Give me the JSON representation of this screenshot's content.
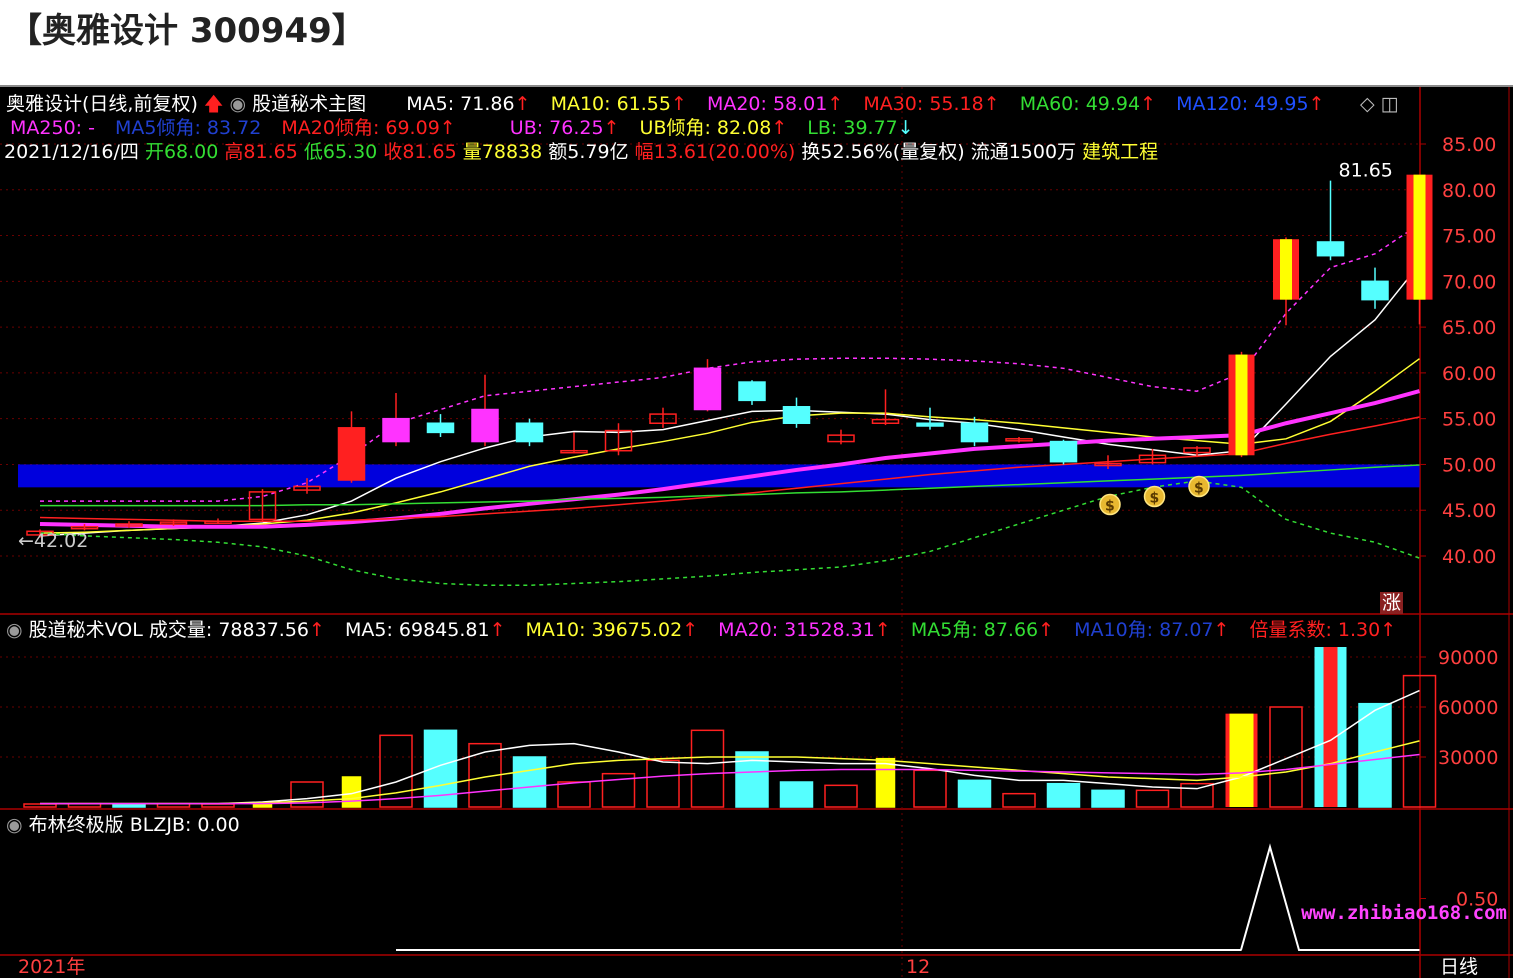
{
  "page_title": "【奥雅设计 300949】",
  "colors": {
    "background": "#000000",
    "grid": "#6a0000",
    "axis": "#aa0000",
    "axis_text": "#ff4040",
    "ma5": "#ffffff",
    "ma10": "#ffff33",
    "ma20": "#ff33ff",
    "ma30": "#ff2020",
    "ma60": "#33dd33",
    "ma120": "#2050ff",
    "band": "#0000dd",
    "boll": "#ff33ff",
    "up": "#ff2020",
    "down": "#55ffff",
    "yellow": "#ffff00",
    "white": "#ffffff",
    "green": "#33dd33",
    "gray": "#cccccc"
  },
  "main_header": {
    "line1": {
      "stock_label": "奥雅设计(日线,前复权)",
      "indicator_name": "股道秘术主图",
      "ma5": "MA5: 71.86",
      "ma10": "MA10: 61.55",
      "ma20": "MA20: 58.01",
      "ma30": "MA30: 55.18",
      "ma60": "MA60: 49.94",
      "ma120": "MA120: 49.95"
    },
    "line2": {
      "ma250": "MA250: -",
      "ma5_angle": "MA5倾角: 83.72",
      "ma20_angle": "MA20倾角: 69.09",
      "ub": "UB: 76.25",
      "ub_angle": "UB倾角: 82.08",
      "lb": "LB: 39.77"
    },
    "line3": {
      "date": "2021/12/16/四",
      "open": "开68.00",
      "high": "高81.65",
      "low": "低65.30",
      "close": "收81.65",
      "volume": "量78838",
      "amount": "额5.79亿",
      "range": "幅13.61(20.00%)",
      "turnover": "换52.56%(量复权)",
      "float": "流通1500万",
      "industry": "建筑工程"
    }
  },
  "vol_header": {
    "name": "股道秘术VOL",
    "volume": "成交量: 78837.56",
    "ma5": "MA5: 69845.81",
    "ma10": "MA10: 39675.02",
    "ma20": "MA20: 31528.31",
    "ma5_angle": "MA5角: 87.66",
    "ma10_angle": "MA10角: 87.07",
    "ratio": "倍量系数: 1.30"
  },
  "boll_header": {
    "name": "布林终极版",
    "value": "BLZJB: 0.00"
  },
  "bottom_axis": {
    "left": "2021年",
    "mid": "12",
    "right": "日线"
  },
  "badge": "涨",
  "watermark": "www.zhibiao168.com",
  "chart_data": [
    {
      "type": "candlestick",
      "y_ticks": [
        "85.00",
        "80.00",
        "75.00",
        "70.00",
        "65.00",
        "60.00",
        "55.00",
        "50.00",
        "45.00",
        "40.00"
      ],
      "ylim": [
        37,
        88
      ],
      "high_annotation": "81.65",
      "low_annotation": "42.02",
      "candles": [
        {
          "o": 42.3,
          "c": 42.7,
          "h": 42.9,
          "l": 42.0
        },
        {
          "o": 43.0,
          "c": 43.2,
          "h": 43.5,
          "l": 42.8
        },
        {
          "o": 43.3,
          "c": 43.5,
          "h": 43.8,
          "l": 43.1
        },
        {
          "o": 43.5,
          "c": 43.7,
          "h": 44.0,
          "l": 43.3
        },
        {
          "o": 43.7,
          "c": 43.8,
          "h": 44.1,
          "l": 43.5
        },
        {
          "o": 44.0,
          "c": 47.0,
          "h": 47.3,
          "l": 43.8
        },
        {
          "o": 47.2,
          "c": 47.6,
          "h": 48.5,
          "l": 46.8
        },
        {
          "o": 48.3,
          "c": 54.0,
          "h": 55.8,
          "l": 48.0
        },
        {
          "o": 52.5,
          "c": 55.0,
          "h": 57.8,
          "l": 52.0
        },
        {
          "o": 54.5,
          "c": 53.5,
          "h": 55.5,
          "l": 53.0
        },
        {
          "o": 52.5,
          "c": 56.0,
          "h": 59.8,
          "l": 52.0
        },
        {
          "o": 54.5,
          "c": 52.5,
          "h": 55.0,
          "l": 52.0
        },
        {
          "o": 51.5,
          "c": 51.5,
          "h": 53.5,
          "l": 51.2
        },
        {
          "o": 51.5,
          "c": 53.7,
          "h": 54.5,
          "l": 51.0
        },
        {
          "o": 54.5,
          "c": 55.5,
          "h": 56.2,
          "l": 54.0
        },
        {
          "o": 56.0,
          "c": 60.5,
          "h": 61.5,
          "l": 55.8
        },
        {
          "o": 59.0,
          "c": 57.0,
          "h": 59.2,
          "l": 56.5
        },
        {
          "o": 56.3,
          "c": 54.5,
          "h": 57.3,
          "l": 54.0
        },
        {
          "o": 52.5,
          "c": 53.2,
          "h": 53.8,
          "l": 52.2
        },
        {
          "o": 54.5,
          "c": 54.9,
          "h": 58.2,
          "l": 54.3
        },
        {
          "o": 54.5,
          "c": 54.2,
          "h": 56.2,
          "l": 53.8
        },
        {
          "o": 54.5,
          "c": 52.5,
          "h": 55.2,
          "l": 52.0
        },
        {
          "o": 52.6,
          "c": 52.8,
          "h": 53.0,
          "l": 52.4
        },
        {
          "o": 52.5,
          "c": 50.3,
          "h": 52.7,
          "l": 50.0
        },
        {
          "o": 50.0,
          "c": 50.1,
          "h": 51.0,
          "l": 49.5
        },
        {
          "o": 50.2,
          "c": 51.0,
          "h": 51.7,
          "l": 50.0
        },
        {
          "o": 51.3,
          "c": 51.8,
          "h": 52.0,
          "l": 50.8
        },
        {
          "o": 51.0,
          "c": 62.0,
          "h": 62.3,
          "l": 50.8
        },
        {
          "o": 68.0,
          "c": 74.6,
          "h": 74.8,
          "l": 65.2
        },
        {
          "o": 74.3,
          "c": 72.8,
          "h": 81.0,
          "l": 72.3
        },
        {
          "o": 70.0,
          "c": 68.0,
          "h": 71.5,
          "l": 67.0
        },
        {
          "o": 68.0,
          "c": 81.65,
          "h": 81.65,
          "l": 65.3
        }
      ],
      "series": [
        {
          "name": "MA5",
          "values": [
            42.2,
            42.5,
            42.8,
            43.0,
            43.2,
            43.6,
            44.5,
            46.0,
            48.5,
            50.3,
            51.8,
            53.0,
            53.6,
            53.5,
            53.8,
            54.8,
            55.8,
            55.9,
            55.7,
            55.5,
            54.9,
            54.5,
            53.8,
            53.0,
            52.2,
            51.6,
            51.0,
            51.5,
            56.6,
            61.8,
            65.8,
            71.86
          ]
        },
        {
          "name": "MA10",
          "values": [
            42.5,
            42.6,
            42.8,
            43.0,
            43.2,
            43.5,
            43.9,
            44.7,
            45.8,
            47.0,
            48.4,
            49.8,
            50.8,
            51.7,
            52.5,
            53.4,
            54.6,
            55.3,
            55.6,
            55.6,
            55.2,
            54.9,
            54.5,
            54.0,
            53.5,
            53.0,
            52.6,
            52.2,
            52.8,
            54.7,
            58.0,
            61.55
          ]
        },
        {
          "name": "MA20",
          "values": [
            43.5,
            43.4,
            43.3,
            43.2,
            43.2,
            43.2,
            43.4,
            43.7,
            44.1,
            44.6,
            45.2,
            45.7,
            46.2,
            46.7,
            47.3,
            48.0,
            48.7,
            49.4,
            50.0,
            50.7,
            51.2,
            51.7,
            52.0,
            52.3,
            52.6,
            52.8,
            53.0,
            53.2,
            54.5,
            55.6,
            56.7,
            58.01
          ]
        },
        {
          "name": "MA30",
          "values": [
            44.2,
            44.1,
            44.0,
            43.9,
            43.8,
            43.8,
            43.8,
            43.9,
            44.1,
            44.3,
            44.6,
            44.9,
            45.2,
            45.6,
            46.0,
            46.4,
            46.9,
            47.4,
            47.9,
            48.4,
            48.9,
            49.3,
            49.7,
            50.0,
            50.3,
            50.6,
            50.9,
            51.2,
            52.3,
            53.3,
            54.2,
            55.18
          ]
        },
        {
          "name": "MA60",
          "values": [
            45.5,
            45.5,
            45.5,
            45.5,
            45.5,
            45.5,
            45.6,
            45.6,
            45.7,
            45.8,
            45.9,
            46.0,
            46.2,
            46.3,
            46.4,
            46.6,
            46.7,
            46.9,
            47.0,
            47.2,
            47.4,
            47.6,
            47.8,
            48.0,
            48.2,
            48.4,
            48.6,
            48.8,
            49.1,
            49.4,
            49.7,
            49.94
          ]
        },
        {
          "name": "UB",
          "values": [
            46.0,
            46.0,
            46.0,
            46.0,
            46.0,
            46.5,
            48.0,
            51.0,
            54.5,
            56.0,
            57.5,
            58.0,
            58.5,
            59.0,
            59.5,
            60.5,
            61.2,
            61.5,
            61.6,
            61.6,
            61.5,
            61.3,
            61.0,
            60.5,
            59.5,
            58.5,
            58.0,
            60.0,
            66.5,
            71.5,
            73.0,
            76.25
          ]
        },
        {
          "name": "LB",
          "values": [
            42.5,
            42.2,
            42.0,
            41.8,
            41.5,
            41.0,
            40.0,
            38.5,
            37.5,
            37.0,
            36.8,
            36.8,
            37.0,
            37.2,
            37.5,
            37.8,
            38.2,
            38.5,
            38.8,
            39.5,
            40.5,
            42.0,
            43.5,
            45.0,
            46.5,
            47.5,
            48.2,
            47.5,
            44.0,
            42.5,
            41.5,
            39.77
          ]
        }
      ],
      "band": {
        "upper": 50.0,
        "lower": 47.5
      }
    },
    {
      "type": "bar",
      "y_ticks": [
        "90000",
        "60000",
        "30000"
      ],
      "ylim": [
        0,
        100000
      ],
      "values": [
        1800,
        2000,
        1800,
        2000,
        1800,
        1800,
        15000,
        18000,
        43000,
        46000,
        38000,
        30000,
        15000,
        20000,
        28000,
        46000,
        33000,
        15000,
        13000,
        29000,
        22000,
        16000,
        8000,
        14000,
        10000,
        10000,
        14000,
        56000,
        60000,
        96000,
        62000,
        78838
      ],
      "fill_styles": [
        "hollow",
        "hollow",
        "cyan",
        "hollow",
        "hollow",
        "yellow",
        "hollow",
        "yellow",
        "hollow",
        "cyan",
        "hollow",
        "cyan",
        "hollow",
        "hollow",
        "hollow",
        "hollow",
        "cyan",
        "cyan",
        "hollow",
        "yellow",
        "hollow",
        "cyan",
        "hollow",
        "cyan",
        "cyan",
        "hollow",
        "hollow",
        "yellow",
        "hollow",
        "red",
        "cyan",
        "hollow"
      ],
      "series": [
        {
          "name": "MA5",
          "values": [
            2000,
            2000,
            2000,
            2000,
            2000,
            3000,
            5000,
            8000,
            15000,
            25000,
            33000,
            37000,
            38000,
            33000,
            27000,
            26000,
            28000,
            27000,
            26000,
            26000,
            23000,
            19000,
            16000,
            16000,
            14000,
            12000,
            11000,
            18000,
            29000,
            40000,
            58000,
            69845.81
          ]
        },
        {
          "name": "MA10",
          "values": [
            2000,
            2000,
            2000,
            2000,
            2000,
            2500,
            3500,
            5000,
            8500,
            13000,
            18000,
            22000,
            26000,
            28000,
            29000,
            30000,
            30000,
            30000,
            29000,
            28000,
            26000,
            24000,
            22000,
            20000,
            18000,
            17000,
            16000,
            18000,
            21000,
            26000,
            33000,
            39675.02
          ]
        },
        {
          "name": "MA20",
          "values": [
            2000,
            2000,
            2000,
            2000,
            2000,
            2000,
            2500,
            3500,
            5000,
            7000,
            9500,
            12000,
            14500,
            16500,
            18500,
            20000,
            21000,
            22000,
            22500,
            22500,
            22500,
            22000,
            21500,
            21000,
            20500,
            20000,
            19500,
            20500,
            22500,
            25500,
            28500,
            31528.31
          ]
        }
      ]
    },
    {
      "type": "line",
      "y_ticks": [
        "0.50"
      ],
      "ylim": [
        0,
        1.2
      ],
      "values": [
        0,
        0,
        0,
        0,
        0,
        0,
        0,
        0,
        0,
        0,
        0,
        0,
        0,
        0,
        0,
        0,
        0,
        0,
        0,
        0,
        0,
        0,
        0,
        0,
        0,
        0,
        0,
        0,
        1,
        0,
        0,
        0
      ],
      "start_index": 8
    }
  ]
}
